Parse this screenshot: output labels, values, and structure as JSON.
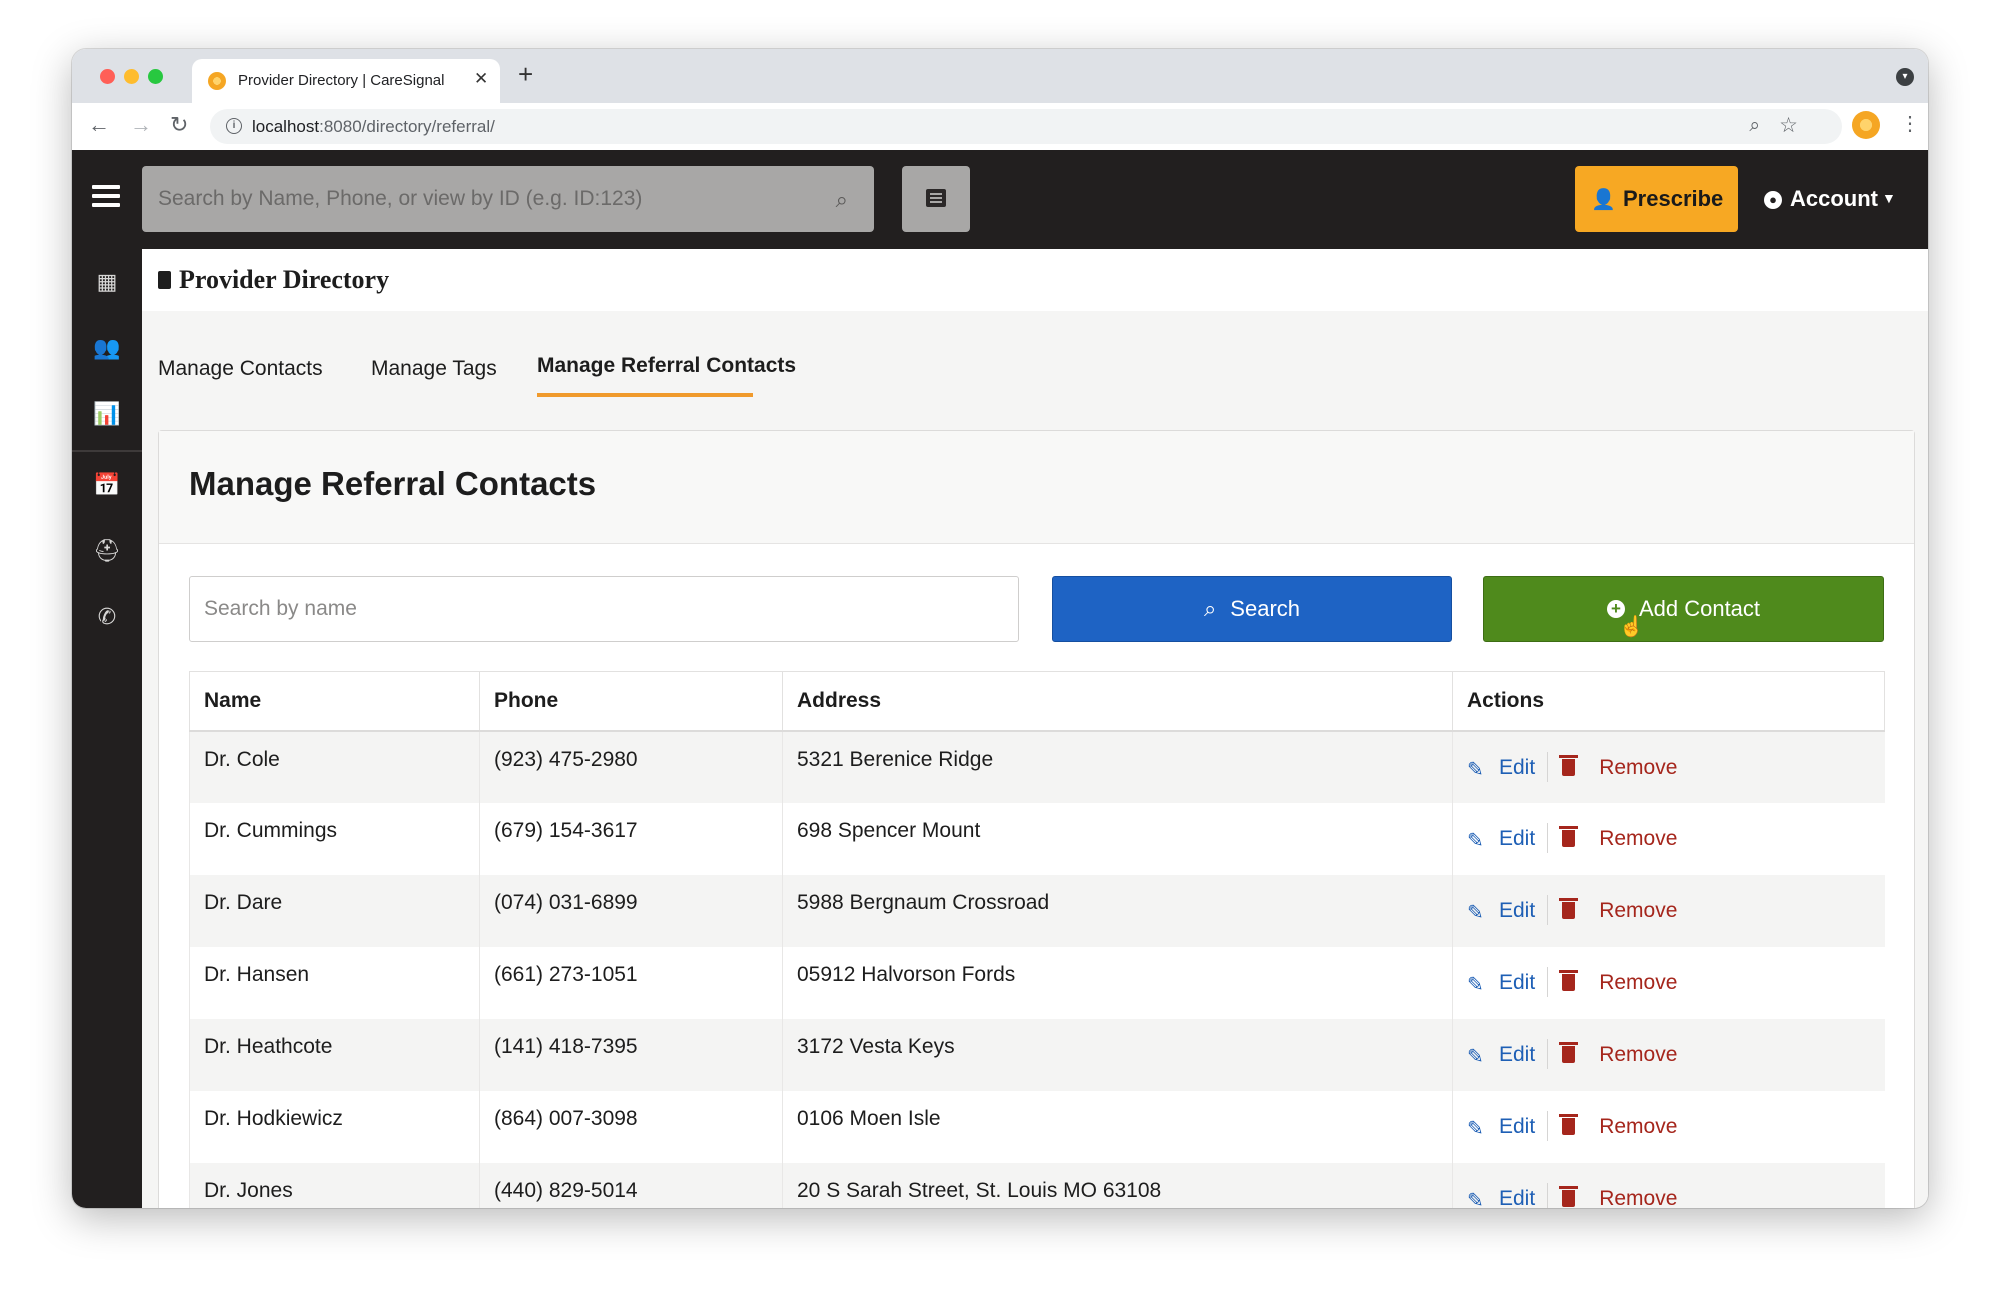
{
  "browser": {
    "tab_title": "Provider Directory | CareSignal",
    "tab_close": "✕",
    "new_tab": "+",
    "url_host": "localhost",
    "url_rest": ":8080/directory/referral/"
  },
  "topbar": {
    "search_placeholder": "Search by Name, Phone, or view by ID (e.g. ID:123)",
    "prescribe_label": "Prescribe",
    "account_label": "Account"
  },
  "sidebar": {
    "items": [
      {
        "icon": "dashboard-icon",
        "glyph": "▦"
      },
      {
        "icon": "users-icon",
        "glyph": "👥"
      },
      {
        "icon": "analytics-icon",
        "glyph": "📊"
      },
      {
        "icon": "calendar-icon",
        "glyph": "📅"
      },
      {
        "icon": "medical-kit-icon",
        "glyph": "⛑"
      },
      {
        "icon": "phone-icon",
        "glyph": "✆"
      }
    ]
  },
  "page": {
    "title": "Provider Directory",
    "tabs": [
      {
        "label": "Manage Contacts",
        "active": false
      },
      {
        "label": "Manage Tags",
        "active": false
      },
      {
        "label": "Manage Referral Contacts",
        "active": true
      }
    ]
  },
  "panel": {
    "title": "Manage Referral Contacts",
    "search_placeholder": "Search by name",
    "search_label": "Search",
    "add_label": "Add Contact"
  },
  "table": {
    "headers": [
      "Name",
      "Phone",
      "Address",
      "Actions"
    ],
    "edit_label": "Edit",
    "remove_label": "Remove",
    "rows": [
      {
        "name": "Dr. Cole",
        "phone": "(923) 475-2980",
        "address": "5321 Berenice Ridge"
      },
      {
        "name": "Dr. Cummings",
        "phone": "(679) 154-3617",
        "address": "698 Spencer Mount"
      },
      {
        "name": "Dr. Dare",
        "phone": "(074) 031-6899",
        "address": "5988 Bergnaum Crossroad"
      },
      {
        "name": "Dr. Hansen",
        "phone": "(661) 273-1051",
        "address": "05912 Halvorson Fords"
      },
      {
        "name": "Dr. Heathcote",
        "phone": "(141) 418-7395",
        "address": "3172 Vesta Keys"
      },
      {
        "name": "Dr. Hodkiewicz",
        "phone": "(864) 007-3098",
        "address": "0106 Moen Isle"
      },
      {
        "name": "Dr. Jones",
        "phone": "(440) 829-5014",
        "address": "20 S Sarah Street, St. Louis MO 63108"
      }
    ]
  },
  "colors": {
    "topbar_bg": "#221f1f",
    "prescribe_bg": "#f7a823",
    "search_btn_bg": "#1e63c4",
    "add_btn_bg": "#4f8a1c",
    "edit_color": "#1e5fb5",
    "remove_color": "#a5261c",
    "tab_underline": "#f09a2c"
  }
}
